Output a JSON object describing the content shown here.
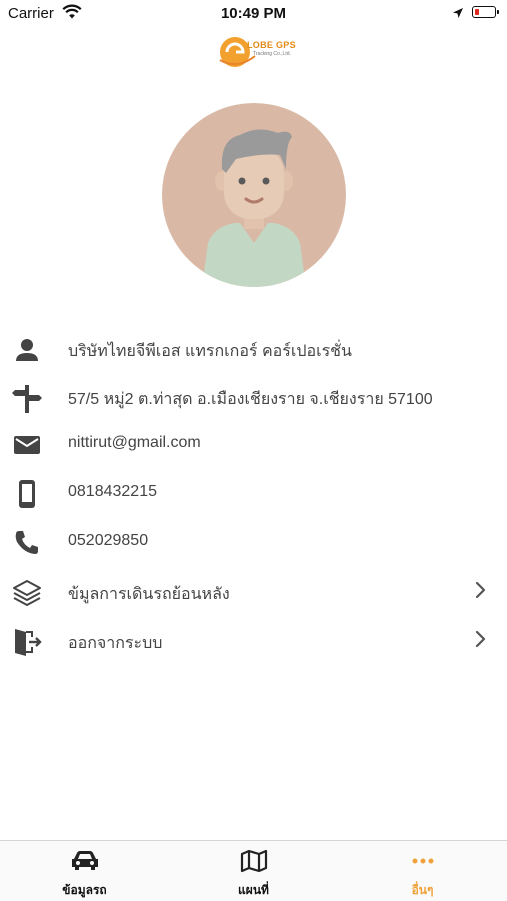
{
  "status_bar": {
    "carrier": "Carrier",
    "time": "10:49 PM"
  },
  "logo": {
    "text": "LOBE GPS",
    "subtitle": "Tracking Co.,Ltd."
  },
  "profile": {
    "items": [
      {
        "icon": "person-icon",
        "text": "บริษัทไทยจีพีเอส แทรกเกอร์ คอร์เปอเรชั่น"
      },
      {
        "icon": "signpost-icon",
        "text": "57/5  หมู่2 ต.ท่าสุด อ.เมืองเชียงราย จ.เชียงราย 57100"
      },
      {
        "icon": "mail-icon",
        "text": "nittirut@gmail.com"
      },
      {
        "icon": "mobile-phone-icon",
        "text": "0818432215"
      },
      {
        "icon": "phone-icon",
        "text": "052029850"
      }
    ],
    "menu": [
      {
        "icon": "layers-icon",
        "text": "ข้มูลการเดินรถย้อนหลัง"
      },
      {
        "icon": "logout-icon",
        "text": "ออกจากระบบ"
      }
    ]
  },
  "tab_bar": {
    "tabs": [
      {
        "icon": "car-icon",
        "label": "ข้อมูลรถ"
      },
      {
        "icon": "map-icon",
        "label": "แผนที่"
      },
      {
        "icon": "more-icon",
        "label": "อื่นๆ"
      }
    ],
    "active_color": "#f0a23a"
  }
}
